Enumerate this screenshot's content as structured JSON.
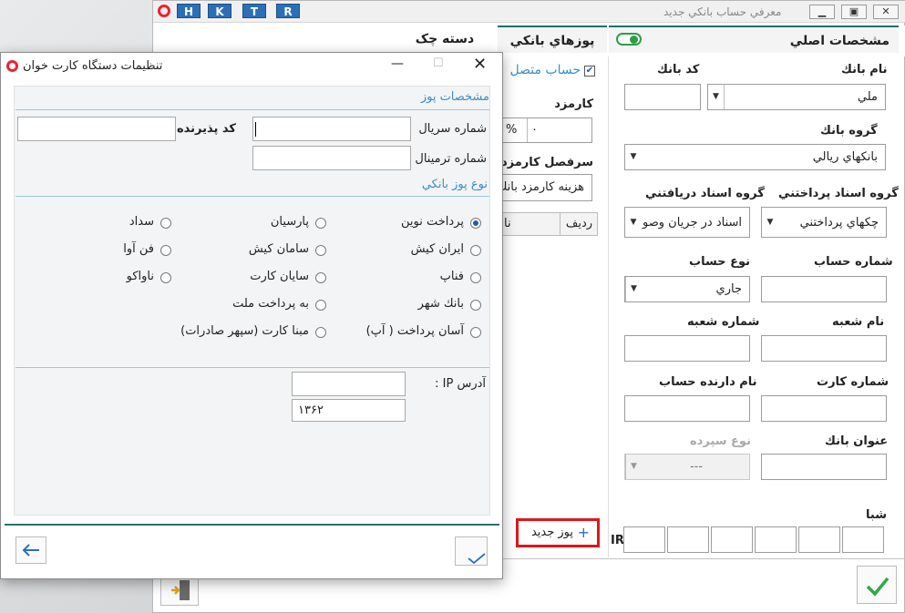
{
  "main_window": {
    "title": "معرفي حساب بانكي جديد",
    "toolbar_buttons": [
      "H",
      "K",
      "T",
      "R"
    ],
    "tabs": {
      "main_info": "مشخصات اصلي",
      "pos": "پوزهاي بانكي",
      "checkbook": "دسته چک"
    },
    "fields": {
      "bank_name_label": "نام بانك",
      "bank_name_value": "ملي",
      "bank_code_label": "كد بانك",
      "bank_group_label": "گروه بانك",
      "bank_group_value": "بانكهاي ريالي",
      "pay_docs_group_label": "گروه اسناد پرداختني",
      "pay_docs_group_value": "چكهاي پرداختني",
      "recv_docs_group_label": "گروه اسناد دريافتني",
      "recv_docs_group_value": "اسناد در جريان وصو",
      "account_number_label": "شماره حساب",
      "account_type_label": "نوع حساب",
      "account_type_value": "جاري",
      "branch_name_label": "نام شعبه",
      "branch_number_label": "شماره شعبه",
      "card_number_label": "شماره كارت",
      "holder_name_label": "نام دارنده حساب",
      "bank_title_label": "عنوان بانك",
      "deposit_type_label": "نوع سپرده",
      "deposit_type_value": "---",
      "sheba_label": "شبا",
      "ir_prefix": "IR"
    },
    "pos_panel": {
      "connected_account": "حساب متصل",
      "fee_label": "كارمزد",
      "fee_value": "۰",
      "percent": "%",
      "fee_heading_label": "سرفصل كارمزد",
      "fee_heading_value": "هزينه كارمزد بانك",
      "col_row": "رديف",
      "col_name": "نا",
      "new_pos_button": "پوز جديد",
      "plus": "+"
    }
  },
  "dialog": {
    "title": "تنظيمات دستگاه كارت خوان",
    "pos_section": "مشخصات پوز",
    "serial_label": "شماره سريال",
    "acceptor_code_label": "كد پذيرنده",
    "terminal_label": "شماره ترمينال",
    "pos_type_section": "نوع پوز بانكي",
    "options": {
      "r1": [
        "پرداخت نوين",
        "پارسيان",
        "سداد"
      ],
      "r2": [
        "ايران كيش",
        "سامان كيش",
        "فن آوا"
      ],
      "r3": [
        "فناپ",
        "سايان كارت",
        "ناواكو"
      ],
      "r4": [
        "بانك شهر",
        "به پرداخت ملت"
      ],
      "r5": [
        "آسان پرداخت ( آپ)",
        "مبنا كارت (سپهر صادرات)"
      ]
    },
    "selected_option": "پرداخت نوين",
    "ip_label": "آدرس IP :",
    "port_value": "۱۳۶۲"
  },
  "colors": {
    "accent_blue": "#2c6fb7",
    "section_blue": "#3b8fc4",
    "highlight_red": "#e0161b",
    "ok_green": "#2eaa4a",
    "toggle_green": "#2e9e46"
  }
}
